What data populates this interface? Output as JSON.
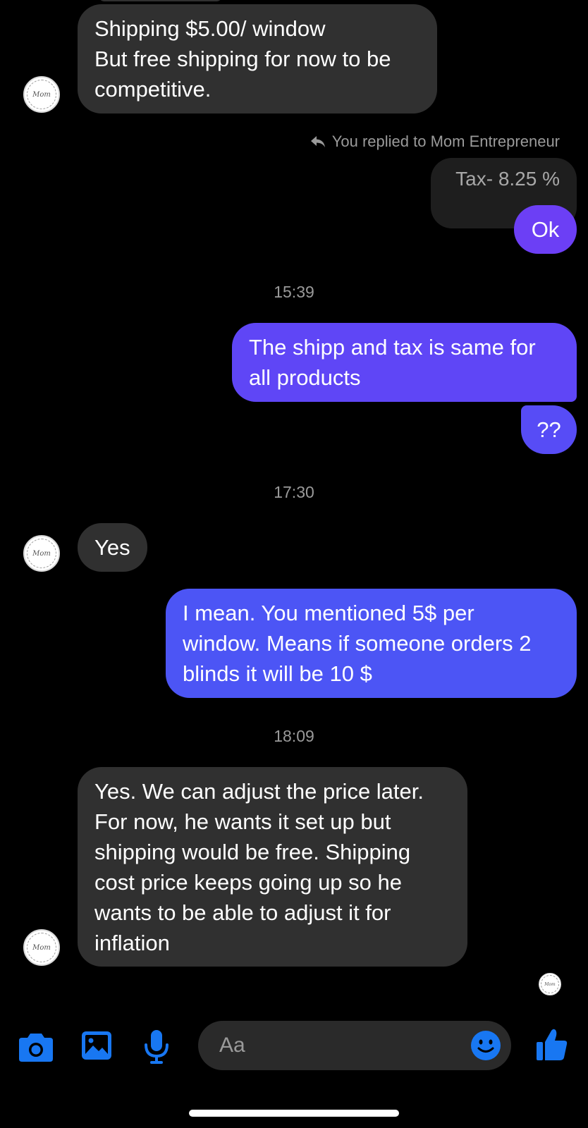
{
  "colors": {
    "accent": "#1877f2",
    "bubble_incoming": "#303030",
    "bubble_purple": "#6c3ff5",
    "bubble_blue": "#4c55f5",
    "background": "#000000"
  },
  "avatar": {
    "label": "Mom"
  },
  "messages": {
    "m1": {
      "lines": [
        "Shipping $5.00/ window",
        "But free shipping for now to be",
        "competitive."
      ]
    },
    "reply_header": "You replied to Mom Entrepreneur",
    "quoted": "Tax- 8.25 %",
    "m2": "Ok",
    "ts1": "15:39",
    "m3": {
      "lines": [
        "The shipp and tax is same for",
        "all products"
      ]
    },
    "m4": "??",
    "ts2": "17:30",
    "m5": "Yes",
    "m6": {
      "lines": [
        "I mean. You mentioned 5$ per",
        "window. Means if someone orders 2",
        "blinds it will be 10 $"
      ]
    },
    "ts3": "18:09",
    "m7": {
      "lines": [
        "Yes. We can adjust the price later.",
        "For now, he wants it set up but",
        "shipping would be free. Shipping",
        "cost price keeps going up so he",
        "wants to be able to adjust it for",
        "inflation"
      ]
    }
  },
  "composer": {
    "placeholder": "Aa",
    "icons": [
      "camera-icon",
      "image-icon",
      "microphone-icon",
      "emoji-icon",
      "thumbs-up-icon"
    ]
  }
}
